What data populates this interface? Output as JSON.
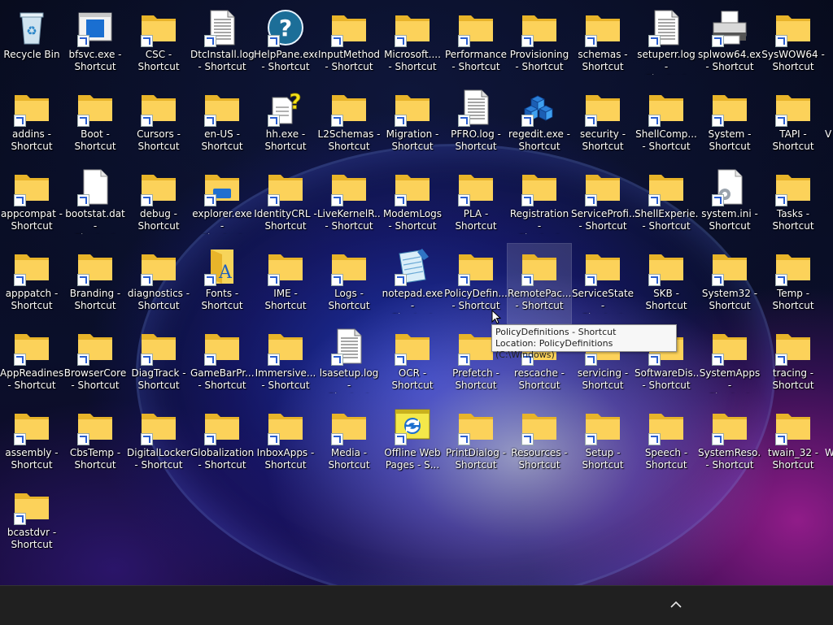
{
  "desktop": {
    "icons": [
      {
        "label": "Recycle Bin",
        "type": "recycle",
        "shortcut": false
      },
      {
        "label": "bfsvc.exe -\nShortcut",
        "type": "app",
        "shortcut": true
      },
      {
        "label": "CSC -\nShortcut",
        "type": "folder",
        "shortcut": true
      },
      {
        "label": "DtcInstall.log\n- Shortcut",
        "type": "doc",
        "shortcut": true
      },
      {
        "label": "HelpPane.exe\n- Shortcut",
        "type": "help",
        "shortcut": true
      },
      {
        "label": "InputMethod\n- Shortcut",
        "type": "folder",
        "shortcut": true
      },
      {
        "label": "Microsoft....\n- Shortcut",
        "type": "folder",
        "shortcut": true
      },
      {
        "label": "Performance\n- Shortcut",
        "type": "folder",
        "shortcut": true
      },
      {
        "label": "Provisioning\n- Shortcut",
        "type": "folder",
        "shortcut": true
      },
      {
        "label": "schemas -\nShortcut",
        "type": "folder",
        "shortcut": true
      },
      {
        "label": "setuperr.log -\nShortcut",
        "type": "doc",
        "shortcut": true
      },
      {
        "label": "splwow64.exe\n- Shortcut",
        "type": "printer",
        "shortcut": true
      },
      {
        "label": "SysWOW64 -\nShortcut",
        "type": "folder",
        "shortcut": true
      },
      {
        "label": "addins -\nShortcut",
        "type": "folder",
        "shortcut": true
      },
      {
        "label": "Boot -\nShortcut",
        "type": "folder",
        "shortcut": true
      },
      {
        "label": "Cursors -\nShortcut",
        "type": "folder",
        "shortcut": true
      },
      {
        "label": "en-US -\nShortcut",
        "type": "folder",
        "shortcut": true
      },
      {
        "label": "hh.exe -\nShortcut",
        "type": "hh",
        "shortcut": true
      },
      {
        "label": "L2Schemas -\nShortcut",
        "type": "folder",
        "shortcut": true
      },
      {
        "label": "Migration -\nShortcut",
        "type": "folder",
        "shortcut": true
      },
      {
        "label": "PFRO.log -\nShortcut",
        "type": "doc",
        "shortcut": true
      },
      {
        "label": "regedit.exe -\nShortcut",
        "type": "regedit",
        "shortcut": true
      },
      {
        "label": "security -\nShortcut",
        "type": "folder",
        "shortcut": true
      },
      {
        "label": "ShellComp...\n- Shortcut",
        "type": "folder",
        "shortcut": true
      },
      {
        "label": "System -\nShortcut",
        "type": "folder",
        "shortcut": true
      },
      {
        "label": "TAPI -\nShortcut",
        "type": "folder",
        "shortcut": true
      },
      {
        "label": "appcompat -\nShortcut",
        "type": "folder",
        "shortcut": true
      },
      {
        "label": "bootstat.dat -\nShortcut",
        "type": "blank",
        "shortcut": true
      },
      {
        "label": "debug -\nShortcut",
        "type": "folder",
        "shortcut": true
      },
      {
        "label": "explorer.exe -\nShortcut",
        "type": "explorer",
        "shortcut": true
      },
      {
        "label": "IdentityCRL -\nShortcut",
        "type": "folder",
        "shortcut": true
      },
      {
        "label": "LiveKernelR...\n- Shortcut",
        "type": "folder",
        "shortcut": true
      },
      {
        "label": "ModemLogs\n- Shortcut",
        "type": "folder",
        "shortcut": true
      },
      {
        "label": "PLA -\nShortcut",
        "type": "folder",
        "shortcut": true
      },
      {
        "label": "Registration -\nShortcut",
        "type": "folder",
        "shortcut": true
      },
      {
        "label": "ServiceProfi...\n- Shortcut",
        "type": "folder",
        "shortcut": true
      },
      {
        "label": "ShellExperie...\n- Shortcut",
        "type": "folder",
        "shortcut": true
      },
      {
        "label": "system.ini -\nShortcut",
        "type": "ini",
        "shortcut": true
      },
      {
        "label": "Tasks -\nShortcut",
        "type": "folder",
        "shortcut": true
      },
      {
        "label": "apppatch -\nShortcut",
        "type": "folder",
        "shortcut": true
      },
      {
        "label": "Branding -\nShortcut",
        "type": "folder",
        "shortcut": true
      },
      {
        "label": "diagnostics -\nShortcut",
        "type": "folder",
        "shortcut": true
      },
      {
        "label": "Fonts -\nShortcut",
        "type": "fonts",
        "shortcut": true
      },
      {
        "label": "IME -\nShortcut",
        "type": "folder",
        "shortcut": true
      },
      {
        "label": "Logs -\nShortcut",
        "type": "folder",
        "shortcut": true
      },
      {
        "label": "notepad.exe -\nShortcut",
        "type": "notepad",
        "shortcut": true
      },
      {
        "label": "PolicyDefin...\n- Shortcut",
        "type": "folder",
        "shortcut": true
      },
      {
        "label": "RemotePac...\n- Shortcut",
        "type": "folder",
        "shortcut": true,
        "hover": true
      },
      {
        "label": "ServiceState -\nShortcut",
        "type": "folder",
        "shortcut": true
      },
      {
        "label": "SKB -\nShortcut",
        "type": "folder",
        "shortcut": true
      },
      {
        "label": "System32 -\nShortcut",
        "type": "folder",
        "shortcut": true
      },
      {
        "label": "Temp -\nShortcut",
        "type": "folder",
        "shortcut": true
      },
      {
        "label": "AppReadiness\n- Shortcut",
        "type": "folder",
        "shortcut": true
      },
      {
        "label": "BrowserCore\n- Shortcut",
        "type": "folder",
        "shortcut": true
      },
      {
        "label": "DiagTrack -\nShortcut",
        "type": "folder",
        "shortcut": true
      },
      {
        "label": "GameBarPr...\n- Shortcut",
        "type": "folder",
        "shortcut": true
      },
      {
        "label": "Immersive...\n- Shortcut",
        "type": "folder",
        "shortcut": true
      },
      {
        "label": "lsasetup.log -\nShortcut",
        "type": "doc",
        "shortcut": true
      },
      {
        "label": "OCR -\nShortcut",
        "type": "folder",
        "shortcut": true
      },
      {
        "label": "Prefetch -\nShortcut",
        "type": "folder",
        "shortcut": true
      },
      {
        "label": "rescache -\nShortcut",
        "type": "folder",
        "shortcut": true
      },
      {
        "label": "servicing -\nShortcut",
        "type": "folder",
        "shortcut": true
      },
      {
        "label": "SoftwareDis...\n- Shortcut",
        "type": "folder",
        "shortcut": true
      },
      {
        "label": "SystemApps -\nShortcut",
        "type": "folder",
        "shortcut": true
      },
      {
        "label": "tracing -\nShortcut",
        "type": "folder",
        "shortcut": true
      },
      {
        "label": "assembly -\nShortcut",
        "type": "folder",
        "shortcut": true
      },
      {
        "label": "CbsTemp -\nShortcut",
        "type": "folder",
        "shortcut": true
      },
      {
        "label": "DigitalLocker\n- Shortcut",
        "type": "folder",
        "shortcut": true
      },
      {
        "label": "Globalization\n- Shortcut",
        "type": "folder",
        "shortcut": true
      },
      {
        "label": "InboxApps -\nShortcut",
        "type": "folder",
        "shortcut": true
      },
      {
        "label": "Media -\nShortcut",
        "type": "folder",
        "shortcut": true
      },
      {
        "label": "Offline Web\nPages - S...",
        "type": "offline",
        "shortcut": true
      },
      {
        "label": "PrintDialog -\nShortcut",
        "type": "folder",
        "shortcut": true
      },
      {
        "label": "Resources -\nShortcut",
        "type": "folder",
        "shortcut": true
      },
      {
        "label": "Setup -\nShortcut",
        "type": "folder",
        "shortcut": true
      },
      {
        "label": "Speech -\nShortcut",
        "type": "folder",
        "shortcut": true
      },
      {
        "label": "SystemReso...\n- Shortcut",
        "type": "folder",
        "shortcut": true
      },
      {
        "label": "twain_32 -\nShortcut",
        "type": "folder",
        "shortcut": true
      },
      {
        "label": "bcastdvr -\nShortcut",
        "type": "folder",
        "shortcut": true
      }
    ],
    "clipped_edge": [
      {
        "row": 1,
        "text": "V"
      },
      {
        "row": 5,
        "text": "W"
      }
    ]
  },
  "tooltip": {
    "line1": "PolicyDefinitions - Shortcut",
    "line2": "Location: PolicyDefinitions (C:\\Windows)"
  },
  "colors": {
    "folder_back": "#e8b42a",
    "folder_front": "#fcd25a",
    "taskbar": "#202020"
  },
  "taskbar": {
    "tray_icon": "chevron-up-icon"
  }
}
